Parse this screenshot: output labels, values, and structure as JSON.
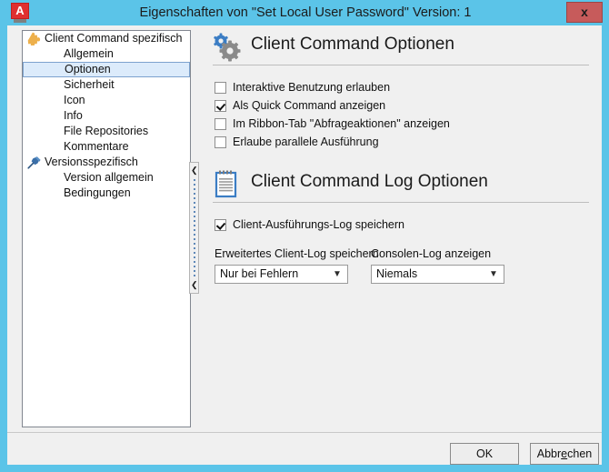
{
  "window": {
    "title": "Eigenschaften von \"Set Local User Password\" Version: 1",
    "app_icon": "autodesk-a-icon",
    "app_icon_letter": "A",
    "close_label": "x",
    "titlebar_color": "#5BC4E8",
    "close_button_color": "#C75B5B"
  },
  "tree": {
    "items": [
      {
        "label": "Client Command spezifisch",
        "level": "root",
        "icon": "puzzle-piece-icon",
        "selected": false
      },
      {
        "label": "Allgemein",
        "level": "child",
        "icon": "",
        "selected": false
      },
      {
        "label": "Optionen",
        "level": "child",
        "icon": "",
        "selected": true
      },
      {
        "label": "Sicherheit",
        "level": "child",
        "icon": "",
        "selected": false
      },
      {
        "label": "Icon",
        "level": "child",
        "icon": "",
        "selected": false
      },
      {
        "label": "Info",
        "level": "child",
        "icon": "",
        "selected": false
      },
      {
        "label": "File Repositories",
        "level": "child",
        "icon": "",
        "selected": false
      },
      {
        "label": "Kommentare",
        "level": "child",
        "icon": "",
        "selected": false
      },
      {
        "label": "Versionsspezifisch",
        "level": "root",
        "icon": "pushpin-icon",
        "selected": false
      },
      {
        "label": "Version allgemein",
        "level": "child",
        "icon": "",
        "selected": false
      },
      {
        "label": "Bedingungen",
        "level": "child",
        "icon": "",
        "selected": false
      }
    ]
  },
  "splitter": {
    "arrow_top": "❮",
    "arrow_bottom": "❮"
  },
  "sections": {
    "options": {
      "title": "Client Command Optionen",
      "icon": "gears-icon",
      "checkboxes": [
        {
          "label": "Interaktive Benutzung erlauben",
          "checked": false
        },
        {
          "label": "Als Quick Command anzeigen",
          "checked": true
        },
        {
          "label": "Im Ribbon-Tab \"Abfrageaktionen\" anzeigen",
          "checked": false
        },
        {
          "label": "Erlaube parallele Ausführung",
          "checked": false
        }
      ]
    },
    "log": {
      "title": "Client Command Log Optionen",
      "icon": "notepad-icon",
      "checkbox": {
        "label": "Client-Ausführungs-Log speichern",
        "checked": true
      },
      "fields": [
        {
          "label": "Erweitertes Client-Log speichern",
          "value": "Nur bei Fehlern"
        },
        {
          "label": "Consolen-Log anzeigen",
          "value": "Niemals"
        }
      ]
    }
  },
  "footer": {
    "ok_label": "OK",
    "cancel_label_before": "Abbr",
    "cancel_label_mnemonic": "e",
    "cancel_label_after": "chen"
  }
}
